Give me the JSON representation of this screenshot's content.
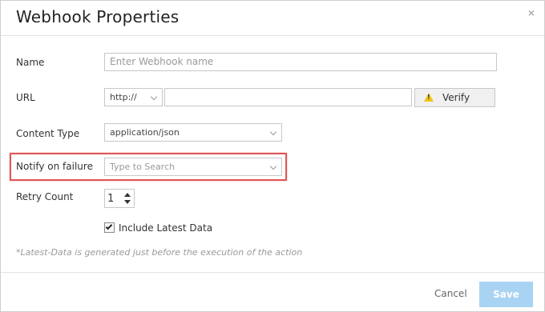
{
  "dialog": {
    "title": "Webhook Properties",
    "close_label": "×"
  },
  "fields": {
    "name": {
      "label": "Name",
      "placeholder": "Enter Webhook name",
      "value": ""
    },
    "url": {
      "label": "URL",
      "scheme": "http://",
      "value": "",
      "verify_label": "Verify",
      "verify_icon": "warning-icon",
      "warning_mark": "!"
    },
    "content_type": {
      "label": "Content Type",
      "value": "application/json"
    },
    "notify_on_failure": {
      "label": "Notify on failure",
      "placeholder": "Type to Search"
    },
    "retry_count": {
      "label": "Retry Count",
      "value": "1"
    },
    "include_latest_data": {
      "label": "Include Latest Data",
      "checked": true
    }
  },
  "note": "*Latest-Data is generated just before the execution of the action",
  "footer": {
    "cancel_label": "Cancel",
    "save_label": "Save"
  },
  "colors": {
    "highlight": "#e05656",
    "save_button": "#a9d3f2",
    "warning": "#f0c419"
  }
}
